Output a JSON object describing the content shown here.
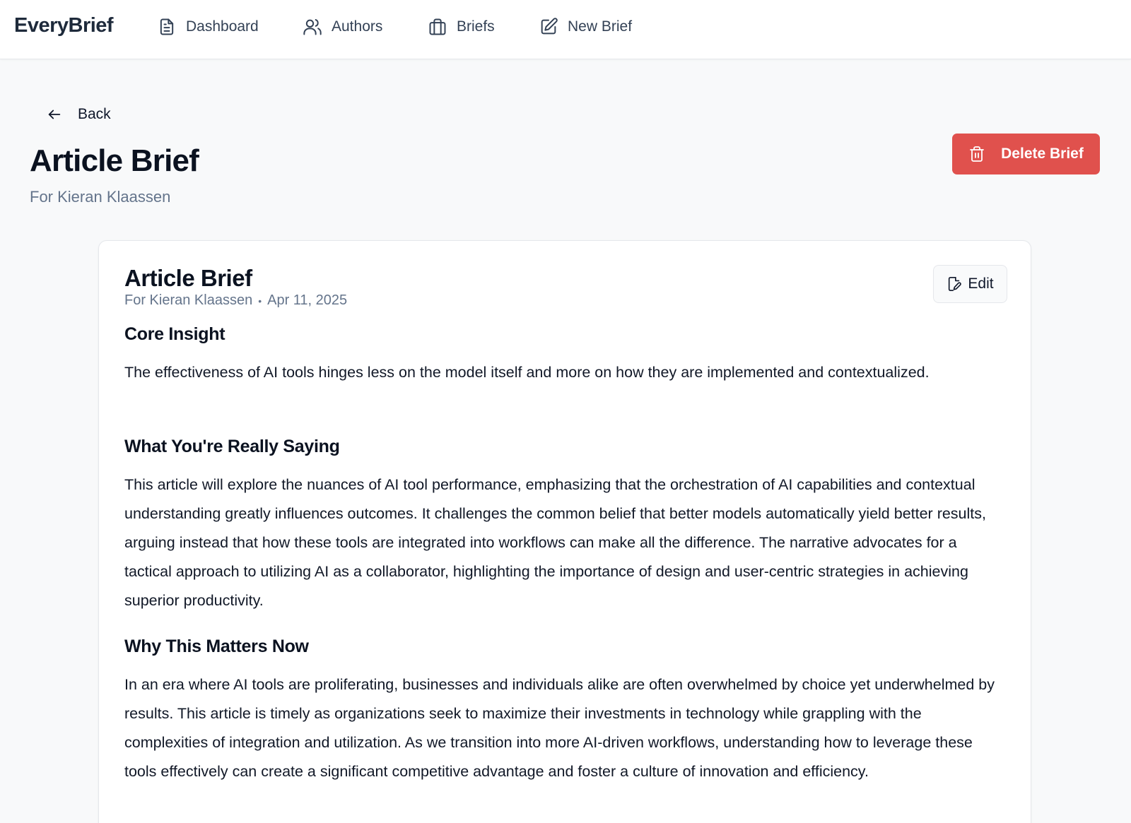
{
  "header": {
    "brand": "EveryBrief",
    "nav": [
      {
        "label": "Dashboard",
        "icon": "document-icon"
      },
      {
        "label": "Authors",
        "icon": "users-icon"
      },
      {
        "label": "Briefs",
        "icon": "briefcase-icon"
      },
      {
        "label": "New Brief",
        "icon": "edit-square-icon"
      }
    ]
  },
  "page": {
    "back_label": "Back",
    "title": "Article Brief",
    "subtitle": "For Kieran Klaassen",
    "delete_label": "Delete Brief"
  },
  "card": {
    "title": "Article Brief",
    "author": "For Kieran Klaassen",
    "date": "Apr 11, 2025",
    "edit_label": "Edit",
    "sections": [
      {
        "heading": "Core Insight",
        "body": "The effectiveness of AI tools hinges less on the model itself and more on how they are implemented and contextualized."
      },
      {
        "heading": "What You're Really Saying",
        "body": "This article will explore the nuances of AI tool performance, emphasizing that the orchestration of AI capabilities and contextual understanding greatly influences outcomes. It challenges the common belief that better models automatically yield better results, arguing instead that how these tools are integrated into workflows can make all the difference. The narrative advocates for a tactical approach to utilizing AI as a collaborator, highlighting the importance of design and user-centric strategies in achieving superior productivity."
      },
      {
        "heading": "Why This Matters Now",
        "body": "In an era where AI tools are proliferating, businesses and individuals alike are often overwhelmed by choice yet underwhelmed by results. This article is timely as organizations seek to maximize their investments in technology while grappling with the complexities of integration and utilization. As we transition into more AI-driven workflows, understanding how to leverage these tools effectively can create a significant competitive advantage and foster a culture of innovation and efficiency."
      }
    ]
  },
  "colors": {
    "danger": "#e0514d",
    "muted_text": "#64748b",
    "background": "#f8f9fa"
  }
}
